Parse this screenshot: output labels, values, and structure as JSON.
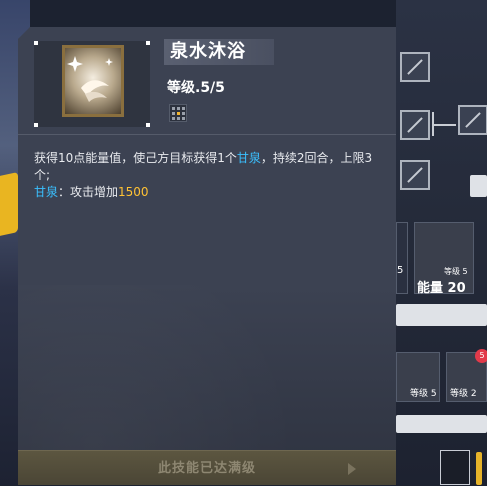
{
  "skill": {
    "name": "泉水沐浴",
    "level": "等级.5/5",
    "description": {
      "part1": "获得10点能量值，使己方目标获得1个",
      "keyword": "甘泉",
      "part2": "，持续2回合，上限3个;",
      "effect_name": "甘泉",
      "effect_text": "：攻击增加",
      "effect_value": "1500"
    },
    "max_button_label": "此技能已达满级"
  },
  "background": {
    "card1_count": "5",
    "card2_level": "等级 5",
    "card2_energy": "能量 20",
    "card3_level": "等级 5",
    "card4_level": "等级 2",
    "badge": "5"
  },
  "colors": {
    "panel": "#3c4252",
    "highlight": "#3ac0ff",
    "number": "#ffc234"
  }
}
